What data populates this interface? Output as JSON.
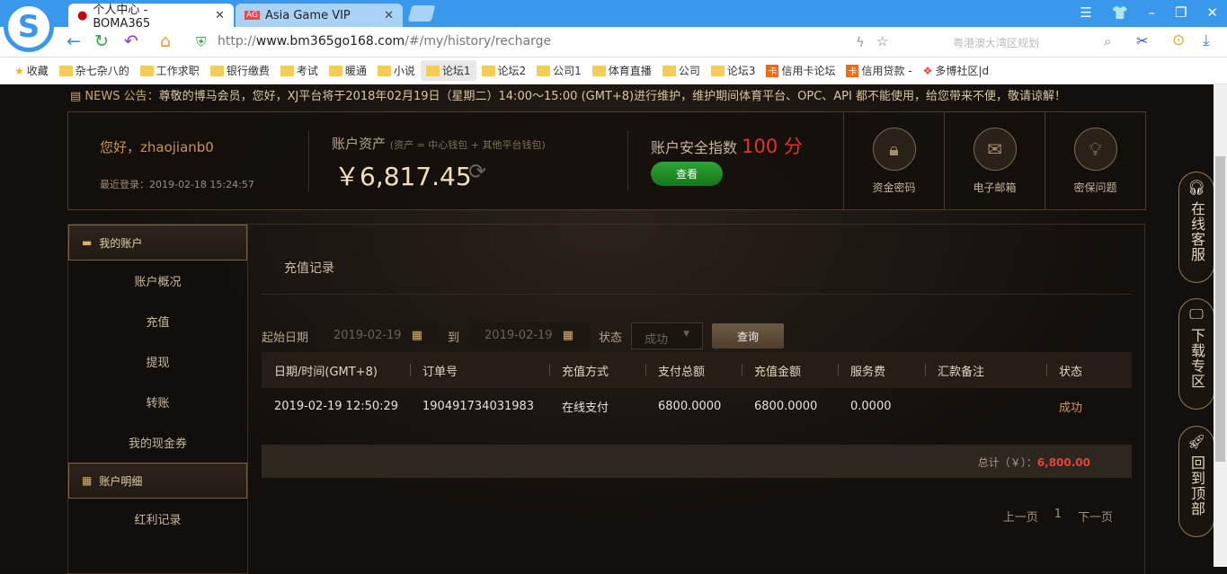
{
  "browser": {
    "tabs": [
      {
        "label": "个人中心 - BOMA365_",
        "active": true
      },
      {
        "label": "Asia Game VIP",
        "active": false
      }
    ],
    "url_prefix": "http://",
    "url_domain": "www.bm365go168.com",
    "url_path": "/#/my/history/recharge",
    "search_placeholder": "粤港澳大湾区规划",
    "bookmarks": [
      {
        "label": "收藏",
        "type": "star"
      },
      {
        "label": "杂七杂八的",
        "type": "folder"
      },
      {
        "label": "工作求职",
        "type": "folder"
      },
      {
        "label": "银行缴费",
        "type": "folder"
      },
      {
        "label": "考试",
        "type": "folder"
      },
      {
        "label": "暖通",
        "type": "folder"
      },
      {
        "label": "小说",
        "type": "folder"
      },
      {
        "label": "论坛1",
        "type": "folder"
      },
      {
        "label": "论坛2",
        "type": "folder"
      },
      {
        "label": "公司1",
        "type": "folder"
      },
      {
        "label": "体育直播",
        "type": "folder"
      },
      {
        "label": "公司",
        "type": "folder"
      },
      {
        "label": "论坛3",
        "type": "folder"
      },
      {
        "label": "信用卡论坛",
        "type": "card"
      },
      {
        "label": "信用贷款 -",
        "type": "card"
      },
      {
        "label": "多博社区|d",
        "type": "site"
      }
    ]
  },
  "news": {
    "tag": "NEWS 公告：",
    "text": "尊敬的博马会员，您好，XJ平台将于2018年02月19日（星期二）14:00～15:00 (GMT+8)进行维护，维护期间体育平台、OPC、API 都不能使用，给您带来不便，敬请谅解！"
  },
  "account": {
    "greeting": "您好，zhaojianb0",
    "last_login": "最近登录：2019-02-18 15:24:57",
    "assets_label": "账户资产",
    "assets_note": "(资产 = 中心钱包 + 其他平台钱包)",
    "assets_amount": "￥6,817.45",
    "security_label": "账户安全指数",
    "security_score": "100 分",
    "view_button": "查看",
    "tiles": [
      "资金密码",
      "电子邮箱",
      "密保问题"
    ]
  },
  "sidebar": {
    "section1": "我的账户",
    "items1": [
      "账户概况",
      "充值",
      "提现",
      "转账",
      "我的现金券"
    ],
    "section2": "账户明细",
    "items2": [
      "红利记录"
    ]
  },
  "main": {
    "title": "充值记录",
    "start_label": "起始日期",
    "start_date": "2019-02-19",
    "to_label": "到",
    "end_date": "2019-02-19",
    "status_label": "状态",
    "status_value": "成功",
    "query_button": "查询",
    "columns": [
      "日期/时间(GMT+8)",
      "订单号",
      "充值方式",
      "支付总额",
      "充值金额",
      "服务费",
      "汇款备注",
      "状态"
    ],
    "rows": [
      [
        "2019-02-19 12:50:29",
        "190491734031983",
        "在线支付",
        "6800.0000",
        "6800.0000",
        "0.0000",
        "",
        "成功"
      ]
    ],
    "total_label": "总计（￥）：",
    "total_value": "6,800.00",
    "prev": "上一页",
    "page": "1",
    "next": "下一页"
  },
  "floating": [
    "在线客服",
    "下载专区",
    "回到顶部"
  ]
}
